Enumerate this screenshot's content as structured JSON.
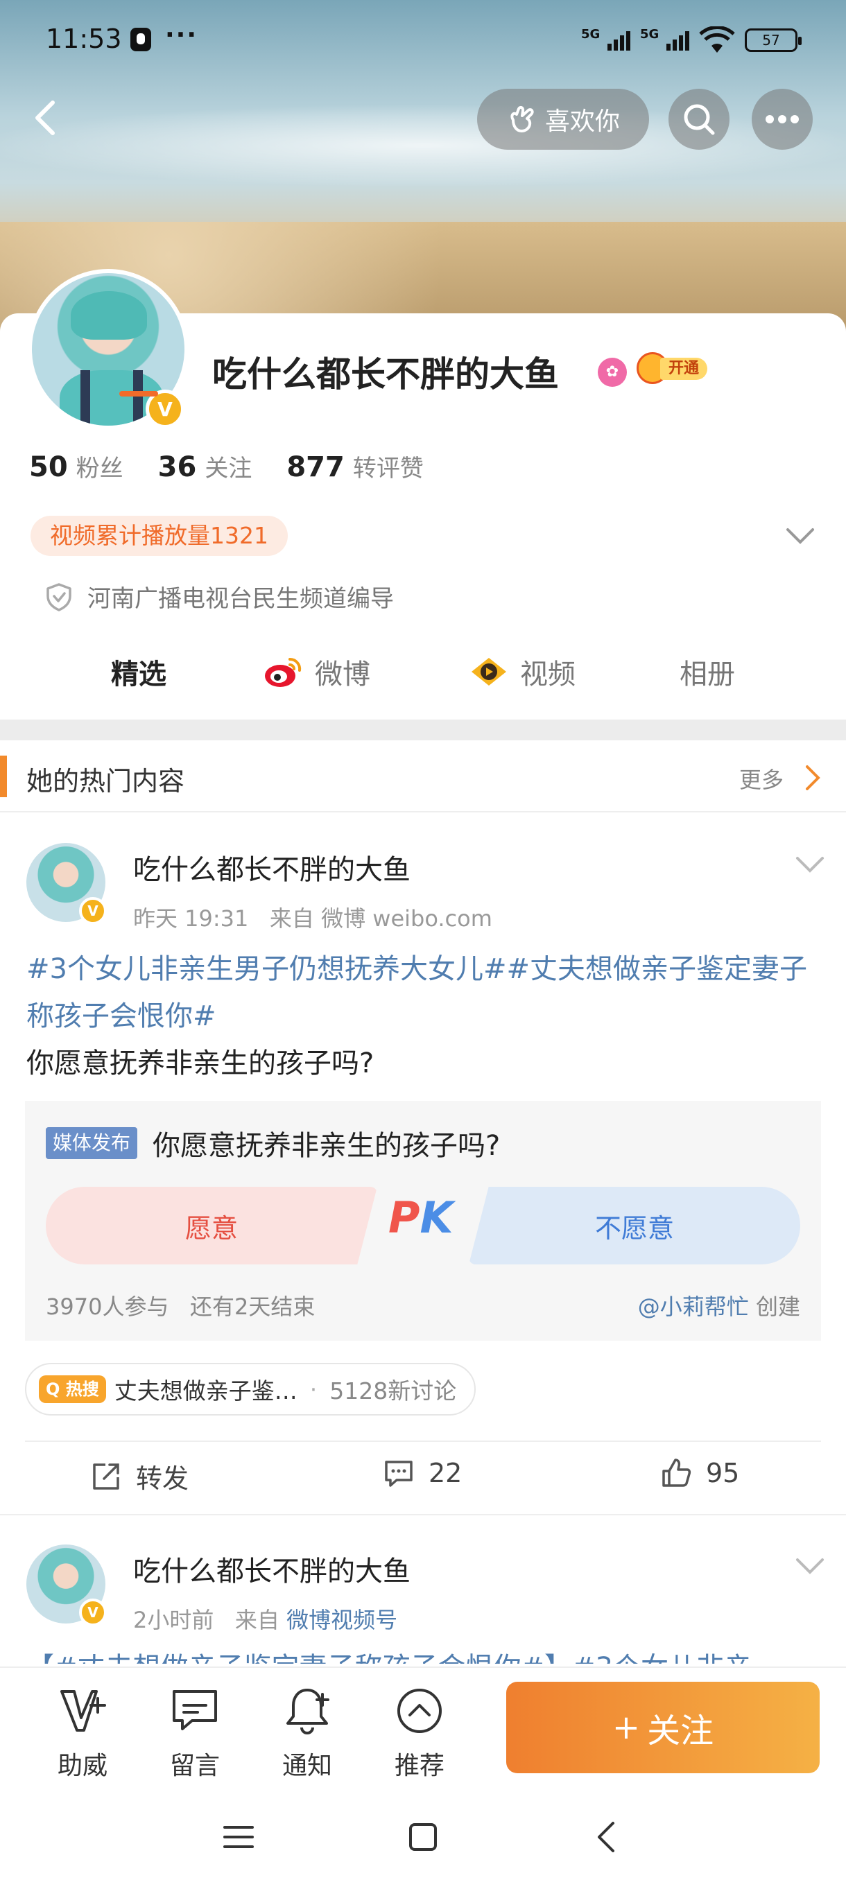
{
  "status_bar": {
    "time": "11:53",
    "dots": "···",
    "signal1_label": "5G",
    "signal2_label": "5G",
    "battery": "57"
  },
  "header": {
    "like_label": "喜欢你"
  },
  "profile": {
    "name": "吃什么都长不胖的大鱼",
    "vip_label": "开通",
    "stats": [
      {
        "value": "50",
        "label": "粉丝"
      },
      {
        "value": "36",
        "label": "关注"
      },
      {
        "value": "877",
        "label": "转评赞"
      }
    ],
    "play_tag": "视频累计播放量1321",
    "certification": "河南广播电视台民生频道编导"
  },
  "tabs": [
    {
      "label": "精选",
      "active": true
    },
    {
      "label": "微博",
      "active": false
    },
    {
      "label": "视频",
      "active": false
    },
    {
      "label": "相册",
      "active": false
    }
  ],
  "hot_section": {
    "title": "她的热门内容",
    "more_label": "更多"
  },
  "post1": {
    "author": "吃什么都长不胖的大鱼",
    "time": "昨天 19:31",
    "from_label": "来自",
    "source": "微博 weibo.com",
    "topic1": "#3个女儿非亲生男子仍想抚养大女儿#",
    "topic2": "#丈夫想做亲子鉴定妻子称孩子会恨你#",
    "body": "你愿意抚养非亲生的孩子吗?",
    "vote": {
      "media_tag": "媒体发布",
      "question": "你愿意抚养非亲生的孩子吗?",
      "option_yes": "愿意",
      "option_no": "不愿意",
      "pk_p": "P",
      "pk_k": "K",
      "participants": "3970人参与",
      "remaining": "还有2天结束",
      "creator_name": "@小莉帮忙",
      "creator_suffix": "创建"
    },
    "hot_search": {
      "badge": "热搜",
      "text": "丈夫想做亲子鉴…",
      "separator": "·",
      "count": "5128新讨论"
    },
    "actions": {
      "repost": "转发",
      "comments": "22",
      "likes": "95"
    }
  },
  "post2": {
    "author": "吃什么都长不胖的大鱼",
    "time": "2小时前",
    "from_label": "来自",
    "source": "微博视频号",
    "preview": "【#丈夫想做亲子鉴定妻子称孩子会恨你#】#3个女儿非亲"
  },
  "bottom_bar": {
    "items": [
      {
        "label": "助威"
      },
      {
        "label": "留言"
      },
      {
        "label": "通知"
      },
      {
        "label": "推荐"
      }
    ],
    "follow_label": "关注",
    "follow_plus": "+"
  },
  "colors": {
    "accent": "#f26b2a",
    "link": "#507daf",
    "verified": "#f5b21c"
  }
}
